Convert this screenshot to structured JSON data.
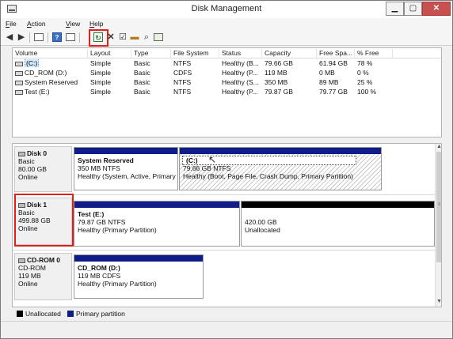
{
  "window": {
    "title": "Disk Management"
  },
  "menu": [
    {
      "label": "File",
      "ul": "F",
      "rest": "ile"
    },
    {
      "label": "Action",
      "ul": "A",
      "rest": "ction"
    },
    {
      "label": "View",
      "ul": "V",
      "rest": "iew"
    },
    {
      "label": "Help",
      "ul": "H",
      "rest": "elp"
    }
  ],
  "toolbar": {
    "icons": [
      "back-arrow-icon",
      "forward-arrow-icon",
      "list-view-icon",
      "help-icon",
      "properties-icon",
      "rescan-disks-icon",
      "delete-icon",
      "check-icon",
      "open-folder-icon",
      "search-icon",
      "refresh-icon"
    ],
    "help_glyph": "?",
    "delete_glyph": "✕"
  },
  "volume_list": {
    "columns": [
      "Volume",
      "Layout",
      "Type",
      "File System",
      "Status",
      "Capacity",
      "Free Spa...",
      "% Free"
    ],
    "rows": [
      {
        "volume": "(C:)",
        "layout": "Simple",
        "type": "Basic",
        "fs": "NTFS",
        "status": "Healthy (B...",
        "capacity": "79.66 GB",
        "free": "61.94 GB",
        "pct": "78 %"
      },
      {
        "volume": "CD_ROM (D:)",
        "layout": "Simple",
        "type": "Basic",
        "fs": "CDFS",
        "status": "Healthy (P...",
        "capacity": "119 MB",
        "free": "0 MB",
        "pct": "0 %"
      },
      {
        "volume": "System Reserved",
        "layout": "Simple",
        "type": "Basic",
        "fs": "NTFS",
        "status": "Healthy (S...",
        "capacity": "350 MB",
        "free": "89 MB",
        "pct": "25 %"
      },
      {
        "volume": "Test (E:)",
        "layout": "Simple",
        "type": "Basic",
        "fs": "NTFS",
        "status": "Healthy (P...",
        "capacity": "79.87 GB",
        "free": "79.77 GB",
        "pct": "100 %"
      }
    ]
  },
  "disks": [
    {
      "name": "Disk 0",
      "kind": "Basic",
      "size": "80.00 GB",
      "state": "Online",
      "partitions": [
        {
          "name": "System Reserved",
          "size": "350 MB NTFS",
          "status": "Healthy (System, Active, Primary"
        },
        {
          "name": "(C:)",
          "size": "79.66 GB NTFS",
          "status": "Healthy (Boot, Page File, Crash Dump, Primary Partition)"
        }
      ]
    },
    {
      "name": "Disk 1",
      "kind": "Basic",
      "size": "499.88 GB",
      "state": "Online",
      "partitions": [
        {
          "name": "Test  (E:)",
          "size": "79.87 GB NTFS",
          "status": "Healthy (Primary Partition)"
        },
        {
          "name": "",
          "size": "420.00 GB",
          "status": "Unallocated"
        }
      ]
    },
    {
      "name": "CD-ROM 0",
      "kind": "CD-ROM",
      "size": "119 MB",
      "state": "Online",
      "partitions": [
        {
          "name": "CD_ROM  (D:)",
          "size": "119 MB CDFS",
          "status": "Healthy (Primary Partition)"
        }
      ]
    }
  ],
  "legend": [
    {
      "label": "Unallocated",
      "color": "#000000"
    },
    {
      "label": "Primary partition",
      "color": "#101c88"
    }
  ],
  "colors": {
    "primary": "#101c88",
    "unallocated": "#000000",
    "highlight": "#e0201b",
    "close": "#c75050"
  }
}
